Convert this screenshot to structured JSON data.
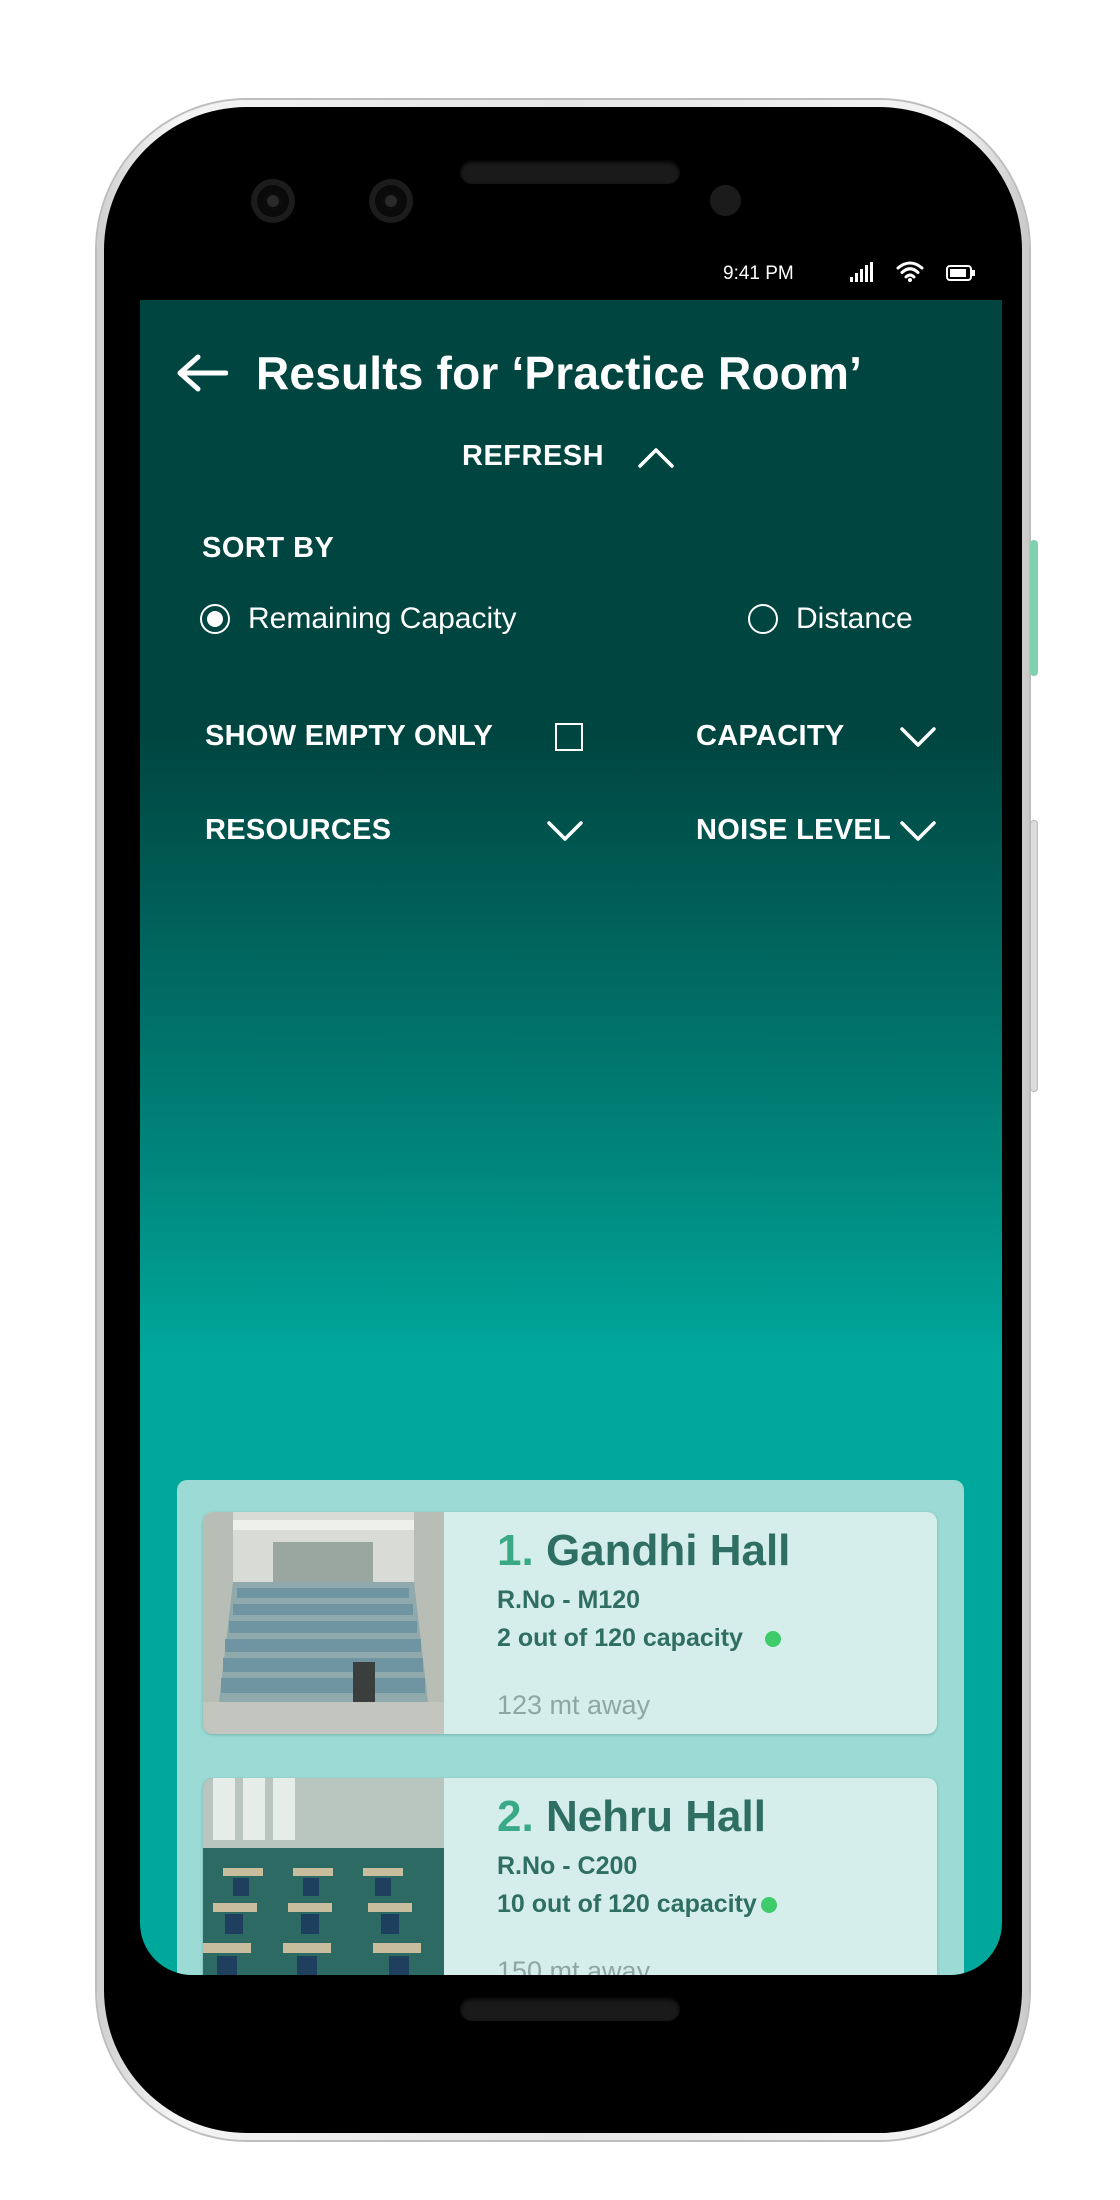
{
  "status_bar": {
    "time": "9:41 PM"
  },
  "header": {
    "title": "Results for ‘Practice Room’"
  },
  "refresh": {
    "label": "REFRESH"
  },
  "sort": {
    "label": "SORT BY",
    "options": [
      {
        "label": "Remaining Capacity",
        "selected": true
      },
      {
        "label": "Distance",
        "selected": false
      }
    ]
  },
  "filters": {
    "show_empty": {
      "label": "SHOW EMPTY ONLY",
      "checked": false
    },
    "capacity": {
      "label": "CAPACITY"
    },
    "resources": {
      "label": "RESOURCES"
    },
    "noise_level": {
      "label": "NOISE LEVEL"
    }
  },
  "results": [
    {
      "index": "1.",
      "name": "Gandhi Hall",
      "room_no": "R.No - M120",
      "capacity": "2 out of 120 capacity",
      "distance": "123 mt away",
      "status_color": "#3ecb6a"
    },
    {
      "index": "2.",
      "name": "Nehru Hall",
      "room_no": "R.No - C200",
      "capacity": "10 out of 120 capacity",
      "distance": "150 mt away",
      "status_color": "#3ecb6a"
    }
  ],
  "colors": {
    "header_bg": "#004540",
    "accent": "#00a79b",
    "card_bg": "#d5eeeb",
    "available": "#3ecb6a"
  }
}
